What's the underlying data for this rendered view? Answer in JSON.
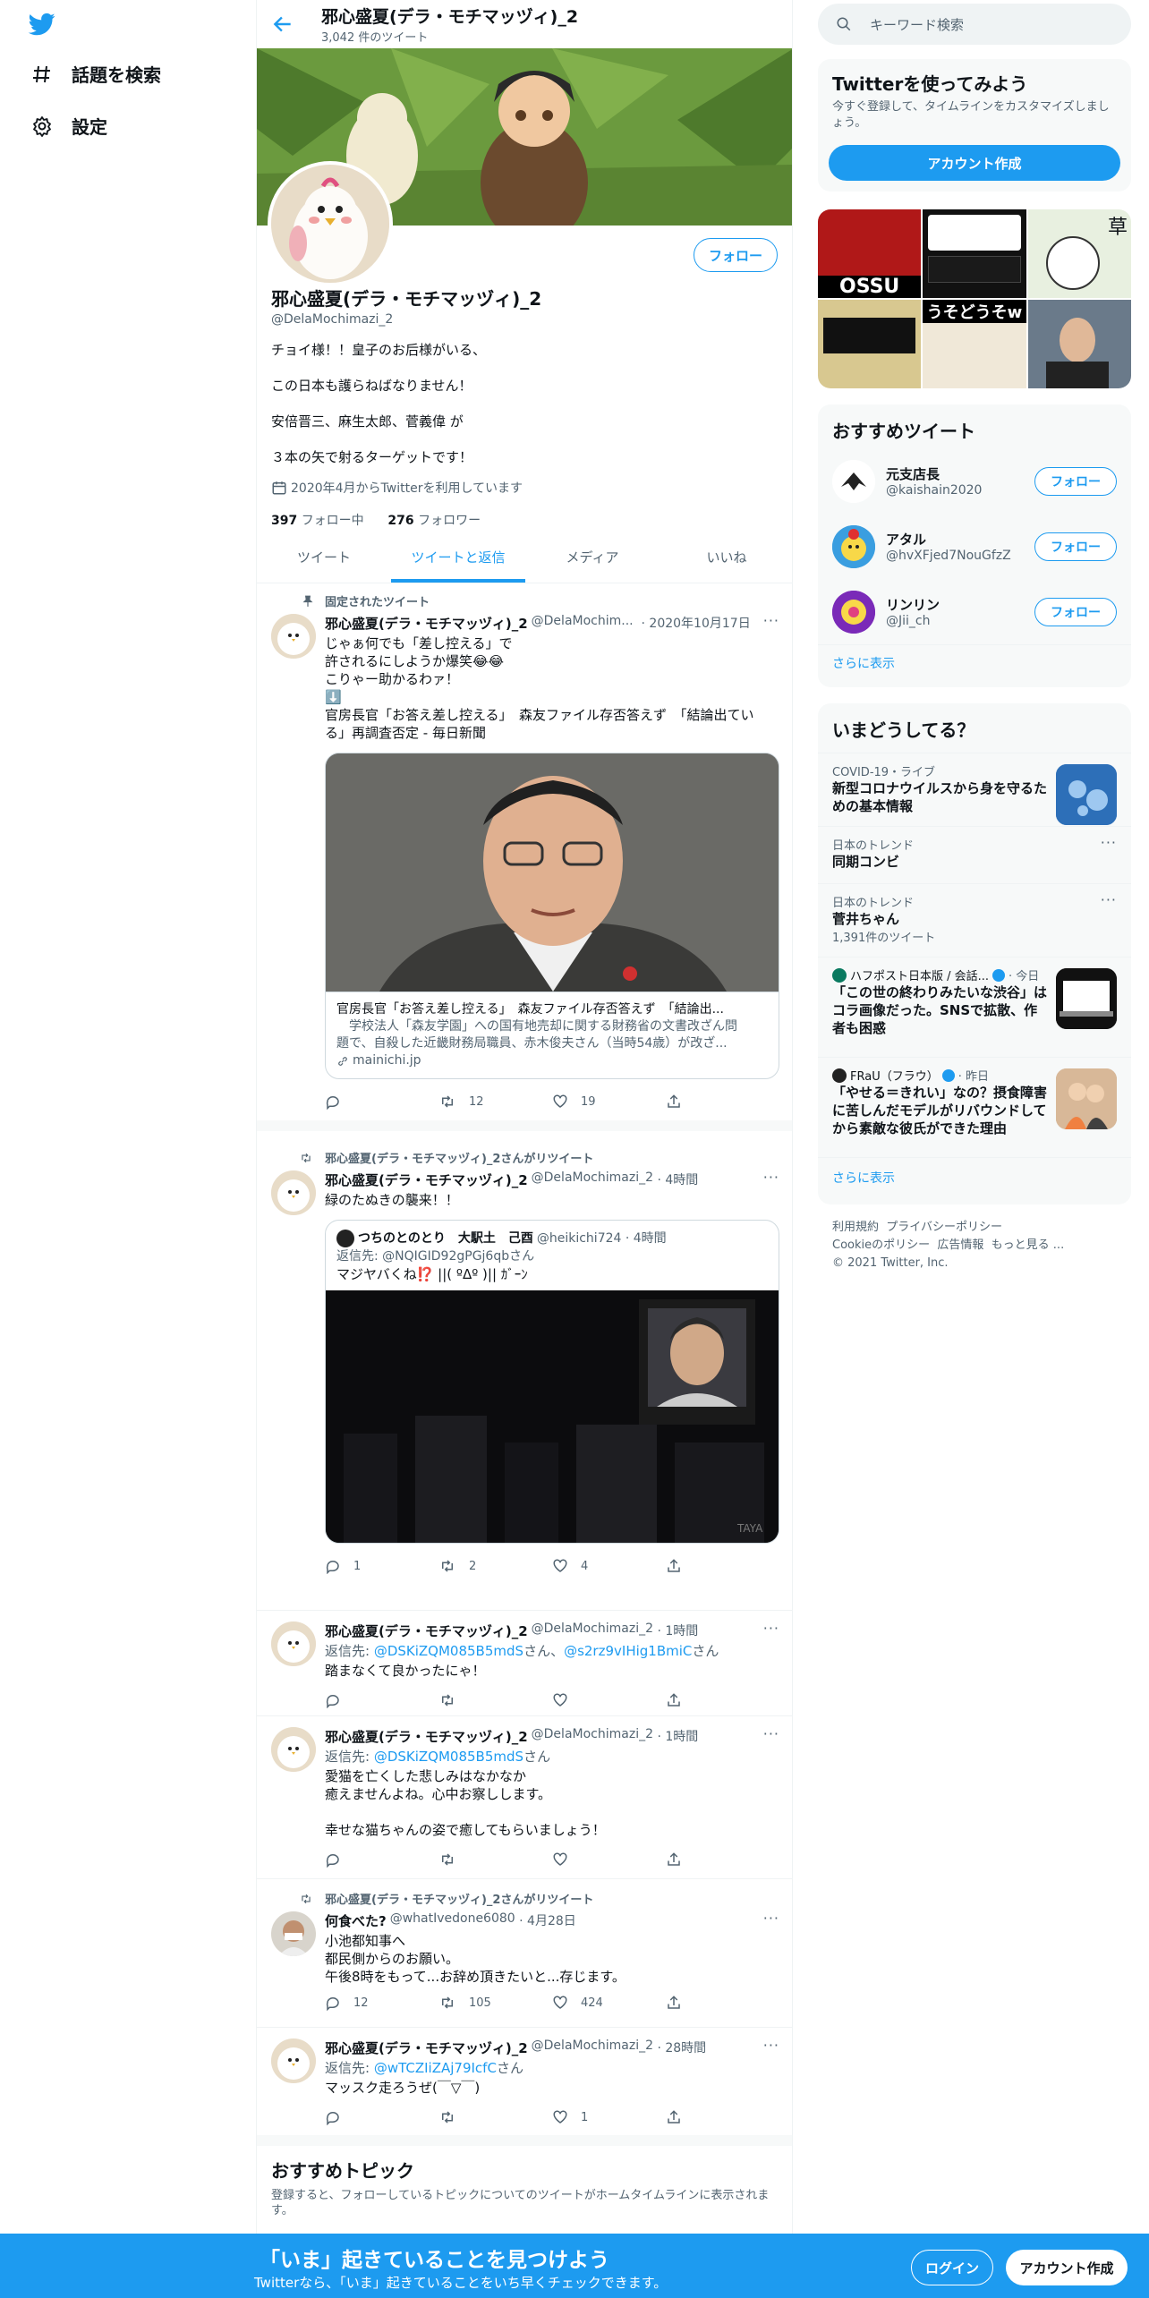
{
  "nav": {
    "explore": "話題を検索",
    "settings": "設定"
  },
  "header": {
    "name": "邪心盛夏(デラ・モチマッヅィ)_2",
    "tweet_count": "3,042 件のツイート"
  },
  "profile": {
    "follow": "フォロー",
    "name": "邪心盛夏(デラ・モチマッヅィ)_2",
    "handle": "@DelaMochimazi_2",
    "bio": [
      "チョイ様！！皇子のお后様がいる、",
      "この日本も護らねばなりません！",
      "安倍晋三、麻生太郎、菅義偉 が",
      "３本の矢で射るターゲットです！"
    ],
    "joined": "2020年4月からTwitterを利用しています",
    "following_count": "397",
    "following_label": "フォロー中",
    "followers_count": "276",
    "followers_label": "フォロワー"
  },
  "tabs": [
    "ツイート",
    "ツイートと返信",
    "メディア",
    "いいね"
  ],
  "tweets": {
    "t1": {
      "context": "固定されたツイート",
      "name": "邪心盛夏(デラ・モチマッヅィ)_2",
      "handle": "@DelaMochim...",
      "time": "· 2020年10月17日",
      "lines": [
        "じゃぁ何でも「差し控える」で",
        "許されるにしようか爆笑😂😂",
        "こりゃー助かるわァ！",
        "⬇️",
        "官房長官「お答え差し控える」　森友ファイル存否答えず　「結論出てい",
        "る」再調査否定 - 毎日新聞"
      ],
      "card_title": "官房長官「お答え差し控える」　森友ファイル存否答えず　「結論出...",
      "card_desc1": "　学校法人「森友学園」への国有地売却に関する財務省の文書改ざん問",
      "card_desc2": "題で、自殺した近畿財務局職員、赤木俊夫さん（当時54歳）が改ざ...",
      "card_domain": "mainichi.jp",
      "retweets": "12",
      "likes": "19"
    },
    "t2": {
      "context": "邪心盛夏(デラ・モチマッヅィ)_2さんがリツイート",
      "name": "邪心盛夏(デラ・モチマッヅィ)_2",
      "handle": "@DelaMochimazi_2",
      "time": "· 4時間",
      "text": "緑のたぬきの襲来！！",
      "quote_name": "つちのとのとり　大駅土　己酉",
      "quote_handle": "@heikichi724 · 4時間",
      "quote_reply_label": "返信先: ",
      "quote_reply_to": "@NQIGID92gPGj6qb",
      "quote_reply_suffix": "さん",
      "quote_text": "マジヤバくね⁉️ ||( ºΔº )|| ｶﾞｰﾝ",
      "replies": "1",
      "retweets": "2",
      "likes": "4"
    },
    "t3": {
      "name": "邪心盛夏(デラ・モチマッヅィ)_2",
      "handle": "@DelaMochimazi_2",
      "time": "· 1時間",
      "reply_label": "返信先: ",
      "reply_to_1": "@DSKiZQM085B5mdS",
      "reply_mid": "さん、",
      "reply_to_2": "@s2rz9vIHig1BmiC",
      "reply_suffix": "さん",
      "text": "踏まなくて良かったにゃ！"
    },
    "t4": {
      "name": "邪心盛夏(デラ・モチマッヅィ)_2",
      "handle": "@DelaMochimazi_2",
      "time": "· 1時間",
      "reply_label": "返信先: ",
      "reply_to": "@DSKiZQM085B5mdS",
      "reply_suffix": "さん",
      "lines": [
        "愛猫を亡くした悲しみはなかなか",
        "癒えませんよね。心中お察しします。",
        "",
        "幸せな猫ちゃんの姿で癒してもらいましょう！"
      ]
    },
    "t5": {
      "context": "邪心盛夏(デラ・モチマッヅィ)_2さんがリツイート",
      "name": "何食べた?",
      "handle": "@whatIvedone6080",
      "time": "· 4月28日",
      "lines": [
        "小池都知事へ",
        "都民側からのお願い。",
        "午後8時をもって...お辞め頂きたいと...存じます。"
      ],
      "replies": "12",
      "retweets": "105",
      "likes": "424"
    },
    "t6": {
      "name": "邪心盛夏(デラ・モチマッヅィ)_2",
      "handle": "@DelaMochimazi_2",
      "time": "· 28時間",
      "reply_label": "返信先: ",
      "reply_to": "@wTCZIiZAj79IcfC",
      "reply_suffix": "さん",
      "text": "マッスク走ろうぜ(￣▽￣)",
      "likes": "1"
    }
  },
  "topics": {
    "title": "おすすめトピック",
    "desc": "登録すると、フォローしているトピックについてのツイートがホームタイムラインに表示されま",
    "desc2": "す。"
  },
  "right": {
    "search_placeholder": "キーワード検索",
    "signup_title": "Twitterを使ってみよう",
    "signup_desc": "今すぐ登録して、タイムラインをカスタマイズしましょう。",
    "signup_button": "アカウント作成",
    "media_text": {
      "ossu": "OSSU",
      "grass": "草",
      "usozoso": "うそどうそw"
    },
    "rec_title": "おすすめツイート",
    "recs": [
      {
        "name": "元支店長",
        "handle": "@kaishain2020",
        "follow": "フォロー"
      },
      {
        "name": "アタル",
        "handle": "@hvXFjed7NouGfzZ",
        "follow": "フォロー"
      },
      {
        "name": "リンリン",
        "handle": "@Jii_ch",
        "follow": "フォロー"
      }
    ],
    "more": "さらに表示",
    "trends_title": "いまどうしてる？",
    "trends": [
      {
        "cat": "COVID-19・ライブ",
        "title": "新型コロナウイルスから身を守るための基本情報"
      },
      {
        "cat": "日本のトレンド",
        "title": "同期コンビ"
      },
      {
        "cat": "日本のトレンド",
        "title": "菅井ちゃん",
        "count": "1,391件のツイート"
      },
      {
        "src": "ハフポスト日本版 / 会話...",
        "time": "· 今日",
        "title": "「この世の終わりみたいな渋谷」はコラ画像だった。SNSで拡散、作者も困惑"
      },
      {
        "src": "FRaU（フラウ）",
        "time": "· 昨日",
        "title": "「やせる＝きれい」なの？摂食障害に苦しんだモデルがリバウンドしてから素敵な彼氏ができた理由"
      }
    ],
    "trends_more": "さらに表示",
    "footer": [
      "利用規約",
      "プライバシーポリシー",
      "Cookieのポリシー",
      "広告情報",
      "もっと見る ...",
      "© 2021 Twitter, Inc."
    ]
  },
  "bottom": {
    "title": "「いま」起きていることを見つけよう",
    "sub": "Twitterなら、「いま」起きていることをいち早くチェックできます。",
    "login": "ログイン",
    "signup": "アカウント作成"
  },
  "colors": {
    "accent": "#1d9bf0",
    "text": "#0f1419",
    "secondary": "#536471"
  }
}
